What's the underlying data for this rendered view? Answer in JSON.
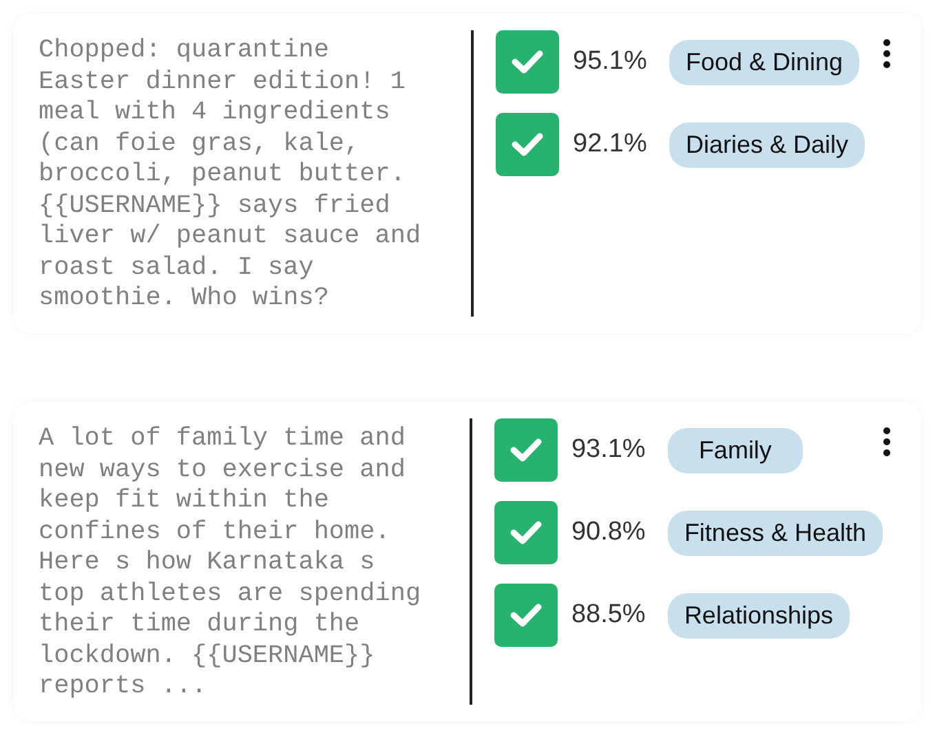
{
  "cards": [
    {
      "text": "Chopped: quarantine\nEaster dinner edition! 1\nmeal with 4 ingredients\n(can foie gras, kale,\nbroccoli, peanut butter.\n{{USERNAME}} says fried\nliver w/ peanut sauce and\nroast salad. I say\nsmoothie. Who wins?",
      "labels": [
        {
          "checked": true,
          "score": "95.1%",
          "category": "Food & Dining"
        },
        {
          "checked": true,
          "score": "92.1%",
          "category": "Diaries & Daily"
        }
      ]
    },
    {
      "text": "A lot of family time and\nnew ways to exercise and\nkeep fit within the\nconfines of their home.\nHere s how Karnataka s\ntop athletes are spending\ntheir time during the\nlockdown. {{USERNAME}}\nreports ...",
      "labels": [
        {
          "checked": true,
          "score": "93.1%",
          "category": "Family"
        },
        {
          "checked": true,
          "score": "90.8%",
          "category": "Fitness & Health"
        },
        {
          "checked": true,
          "score": "88.5%",
          "category": "Relationships"
        }
      ]
    }
  ]
}
